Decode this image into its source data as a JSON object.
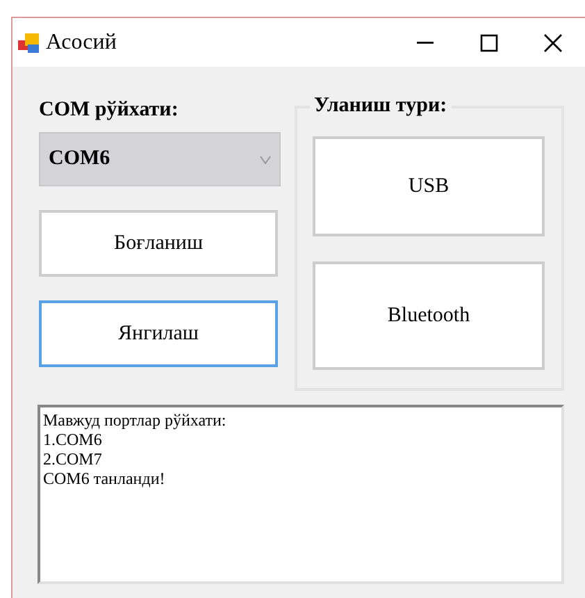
{
  "window": {
    "title": "Асосий"
  },
  "com_list": {
    "label": "COM рўйхати:",
    "value": "COM6"
  },
  "buttons": [
    {
      "label": "Боғланиш",
      "focused": false
    },
    {
      "label": "Янгилаш",
      "focused": true
    }
  ],
  "connection_type": {
    "legend": "Уланиш тури:",
    "buttons": [
      {
        "label": "USB"
      },
      {
        "label": "Bluetooth"
      }
    ]
  },
  "log": {
    "lines": [
      "Мавжуд портлар рўйхати:",
      "1.COM6",
      "2.COM7",
      "COM6 танланди!"
    ]
  }
}
